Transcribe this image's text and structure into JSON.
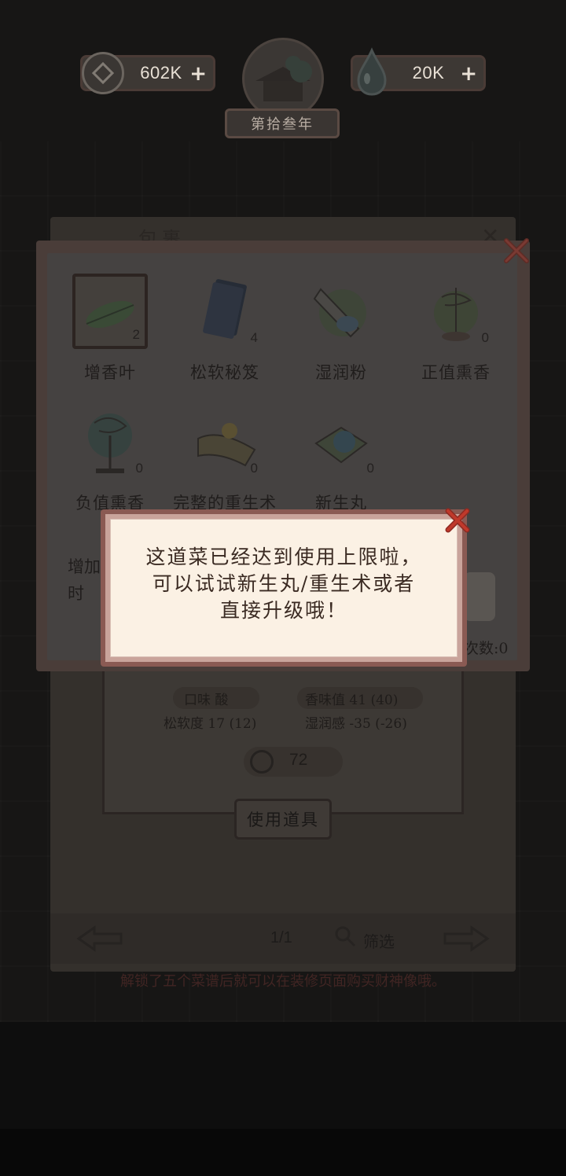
{
  "currency": {
    "coins": "602K",
    "soul": "20K",
    "plus": "+"
  },
  "year_label": "第拾叁年",
  "bag": {
    "title": "包裹"
  },
  "inventory": {
    "items": [
      {
        "name": "增香叶",
        "count": "2",
        "icon": "leaf-icon"
      },
      {
        "name": "松软秘笈",
        "count": "4",
        "icon": "book-icon"
      },
      {
        "name": "湿润粉",
        "count": "",
        "icon": "powder-bag-icon"
      },
      {
        "name": "正值熏香",
        "count": "0",
        "icon": "incense-icon"
      },
      {
        "name": "负值熏香",
        "count": "0",
        "icon": "incense-stand-icon"
      },
      {
        "name": "完整的重生术",
        "count": "0",
        "icon": "scroll-icon"
      },
      {
        "name": "新生丸",
        "count": "0",
        "icon": "pill-icon"
      }
    ],
    "partial_left": "增加\n时",
    "partial_right": "次数:0"
  },
  "stats": {
    "taste": "口味 酸",
    "aroma": "香味值 41 (40)",
    "softness": "松软度 17 (12)",
    "moisture": "湿润感 -35 (-26)",
    "price": "72"
  },
  "use_button": "使用道具",
  "pager": {
    "page": "1/1",
    "filter": "筛选"
  },
  "tip": "解锁了五个菜谱后就可以在装修页面购买财神像哦。",
  "dialog": {
    "message_line1": "这道菜已经达到使用上限啦，",
    "message_line2": "可以试试新生丸/重生术或者",
    "message_line3": "直接升级哦！"
  },
  "colors": {
    "dialog_bg": "#fbf1e4",
    "dialog_border": "#8a5a53",
    "close_red": "#c0392b",
    "overlay": "#171615"
  }
}
